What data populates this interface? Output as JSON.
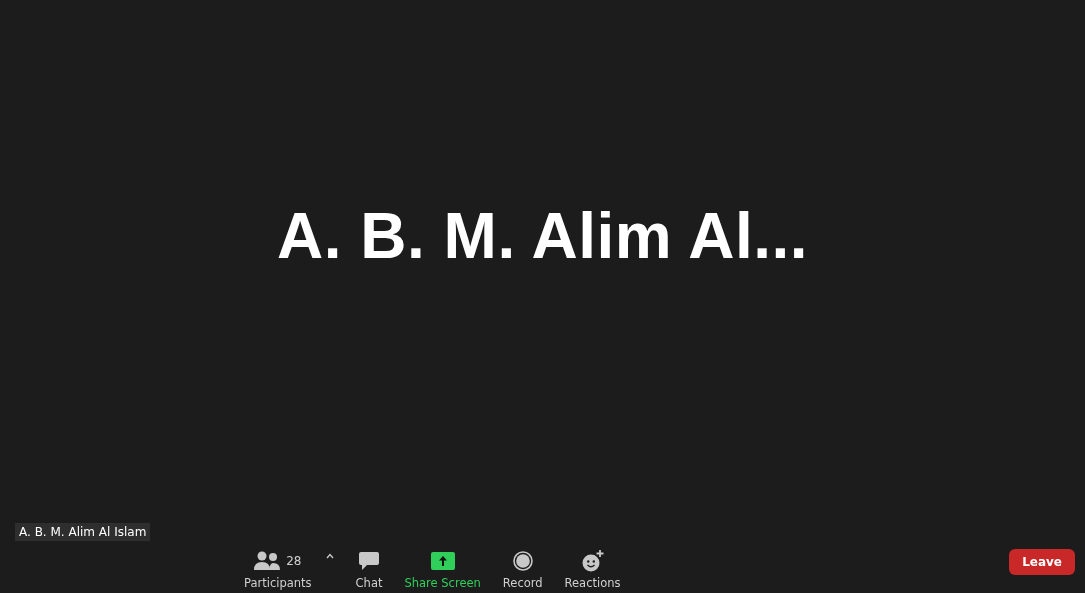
{
  "video_tile": {
    "display_name": "A. B. M. Alim Al...",
    "name_tag": "A. B. M. Alim Al Islam"
  },
  "toolbar": {
    "items": [
      {
        "kind": "participants",
        "label": "Participants",
        "count": "28"
      },
      {
        "kind": "chat",
        "label": "Chat"
      },
      {
        "kind": "share",
        "label": "Share Screen"
      },
      {
        "kind": "record",
        "label": "Record"
      },
      {
        "kind": "reactions",
        "label": "Reactions"
      }
    ],
    "leave_button": "Leave"
  }
}
